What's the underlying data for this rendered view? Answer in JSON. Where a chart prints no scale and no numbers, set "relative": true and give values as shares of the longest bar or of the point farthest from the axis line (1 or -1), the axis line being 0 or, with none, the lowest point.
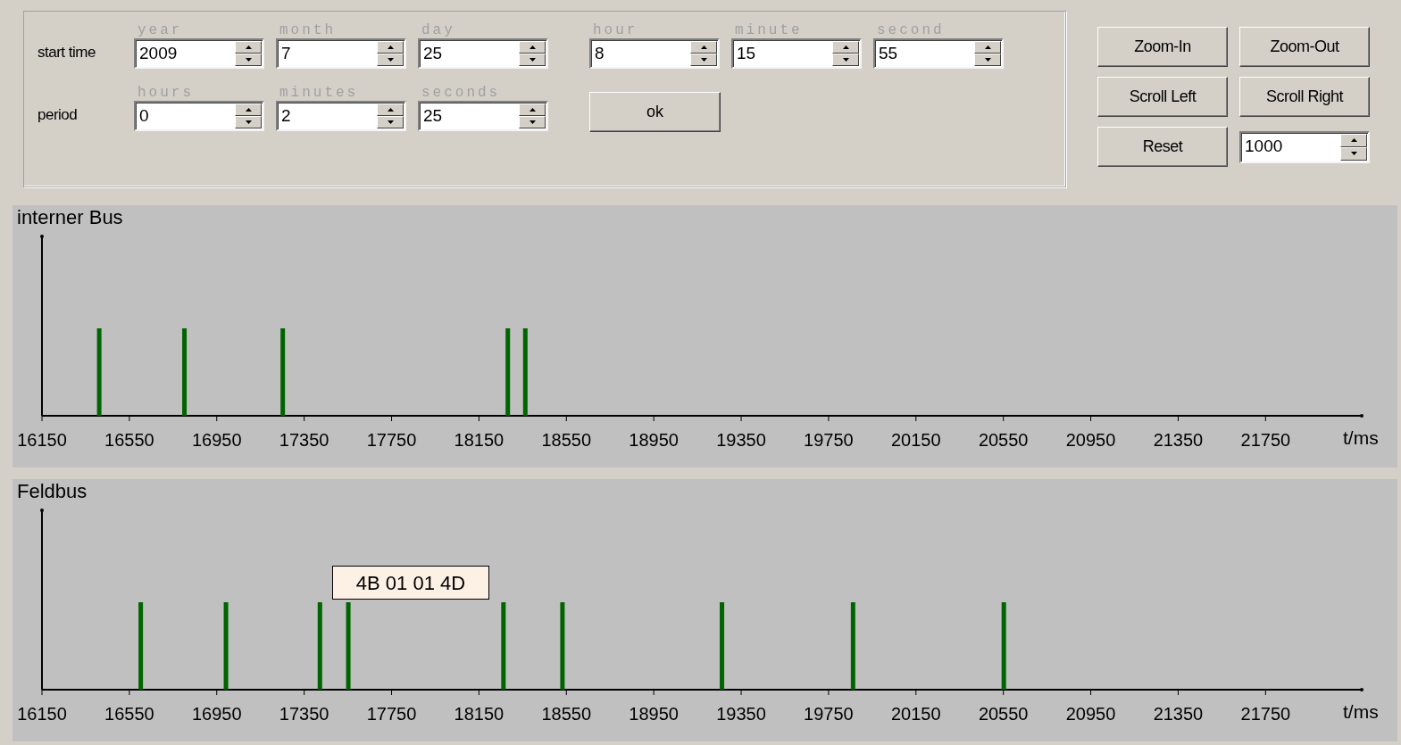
{
  "start_time": {
    "label": "start time",
    "fields": [
      {
        "caption": "year",
        "value": "2009"
      },
      {
        "caption": "month",
        "value": "7"
      },
      {
        "caption": "day",
        "value": "25"
      },
      {
        "caption": "hour",
        "value": "8"
      },
      {
        "caption": "minute",
        "value": "15"
      },
      {
        "caption": "second",
        "value": "55"
      }
    ]
  },
  "period": {
    "label": "period",
    "fields": [
      {
        "caption": "hours",
        "value": "0"
      },
      {
        "caption": "minutes",
        "value": "2"
      },
      {
        "caption": "seconds",
        "value": "25"
      }
    ]
  },
  "ok_button": "ok",
  "view_controls": {
    "buttons": [
      "Zoom-In",
      "Zoom-Out",
      "Scroll Left",
      "Scroll Right",
      "Reset"
    ],
    "step": "1000"
  },
  "charts": [
    {
      "chart_data": {
        "type": "bar",
        "relative": true,
        "title": "interner Bus",
        "xlabel": "t/ms",
        "xlim": [
          16150,
          22190
        ],
        "xticks": [
          16150,
          16550,
          16950,
          17350,
          17750,
          18150,
          18550,
          18950,
          19350,
          19750,
          20150,
          20550,
          20950,
          21350,
          21750
        ],
        "x": [
          16410,
          16800,
          17250,
          18280,
          18360
        ],
        "values": [
          1,
          1,
          1,
          1,
          1
        ]
      }
    },
    {
      "tooltip": "4B 01 01 4D",
      "chart_data": {
        "type": "bar",
        "relative": true,
        "title": "Feldbus",
        "xlabel": "t/ms",
        "xlim": [
          16150,
          22190
        ],
        "xticks": [
          16150,
          16550,
          16950,
          17350,
          17750,
          18150,
          18550,
          18950,
          19350,
          19750,
          20150,
          20550,
          20950,
          21350,
          21750
        ],
        "x": [
          16600,
          16990,
          17420,
          17550,
          18260,
          18530,
          19260,
          19860,
          20550
        ],
        "values": [
          1,
          1,
          1,
          1,
          1,
          1,
          1,
          1,
          1
        ]
      }
    }
  ]
}
